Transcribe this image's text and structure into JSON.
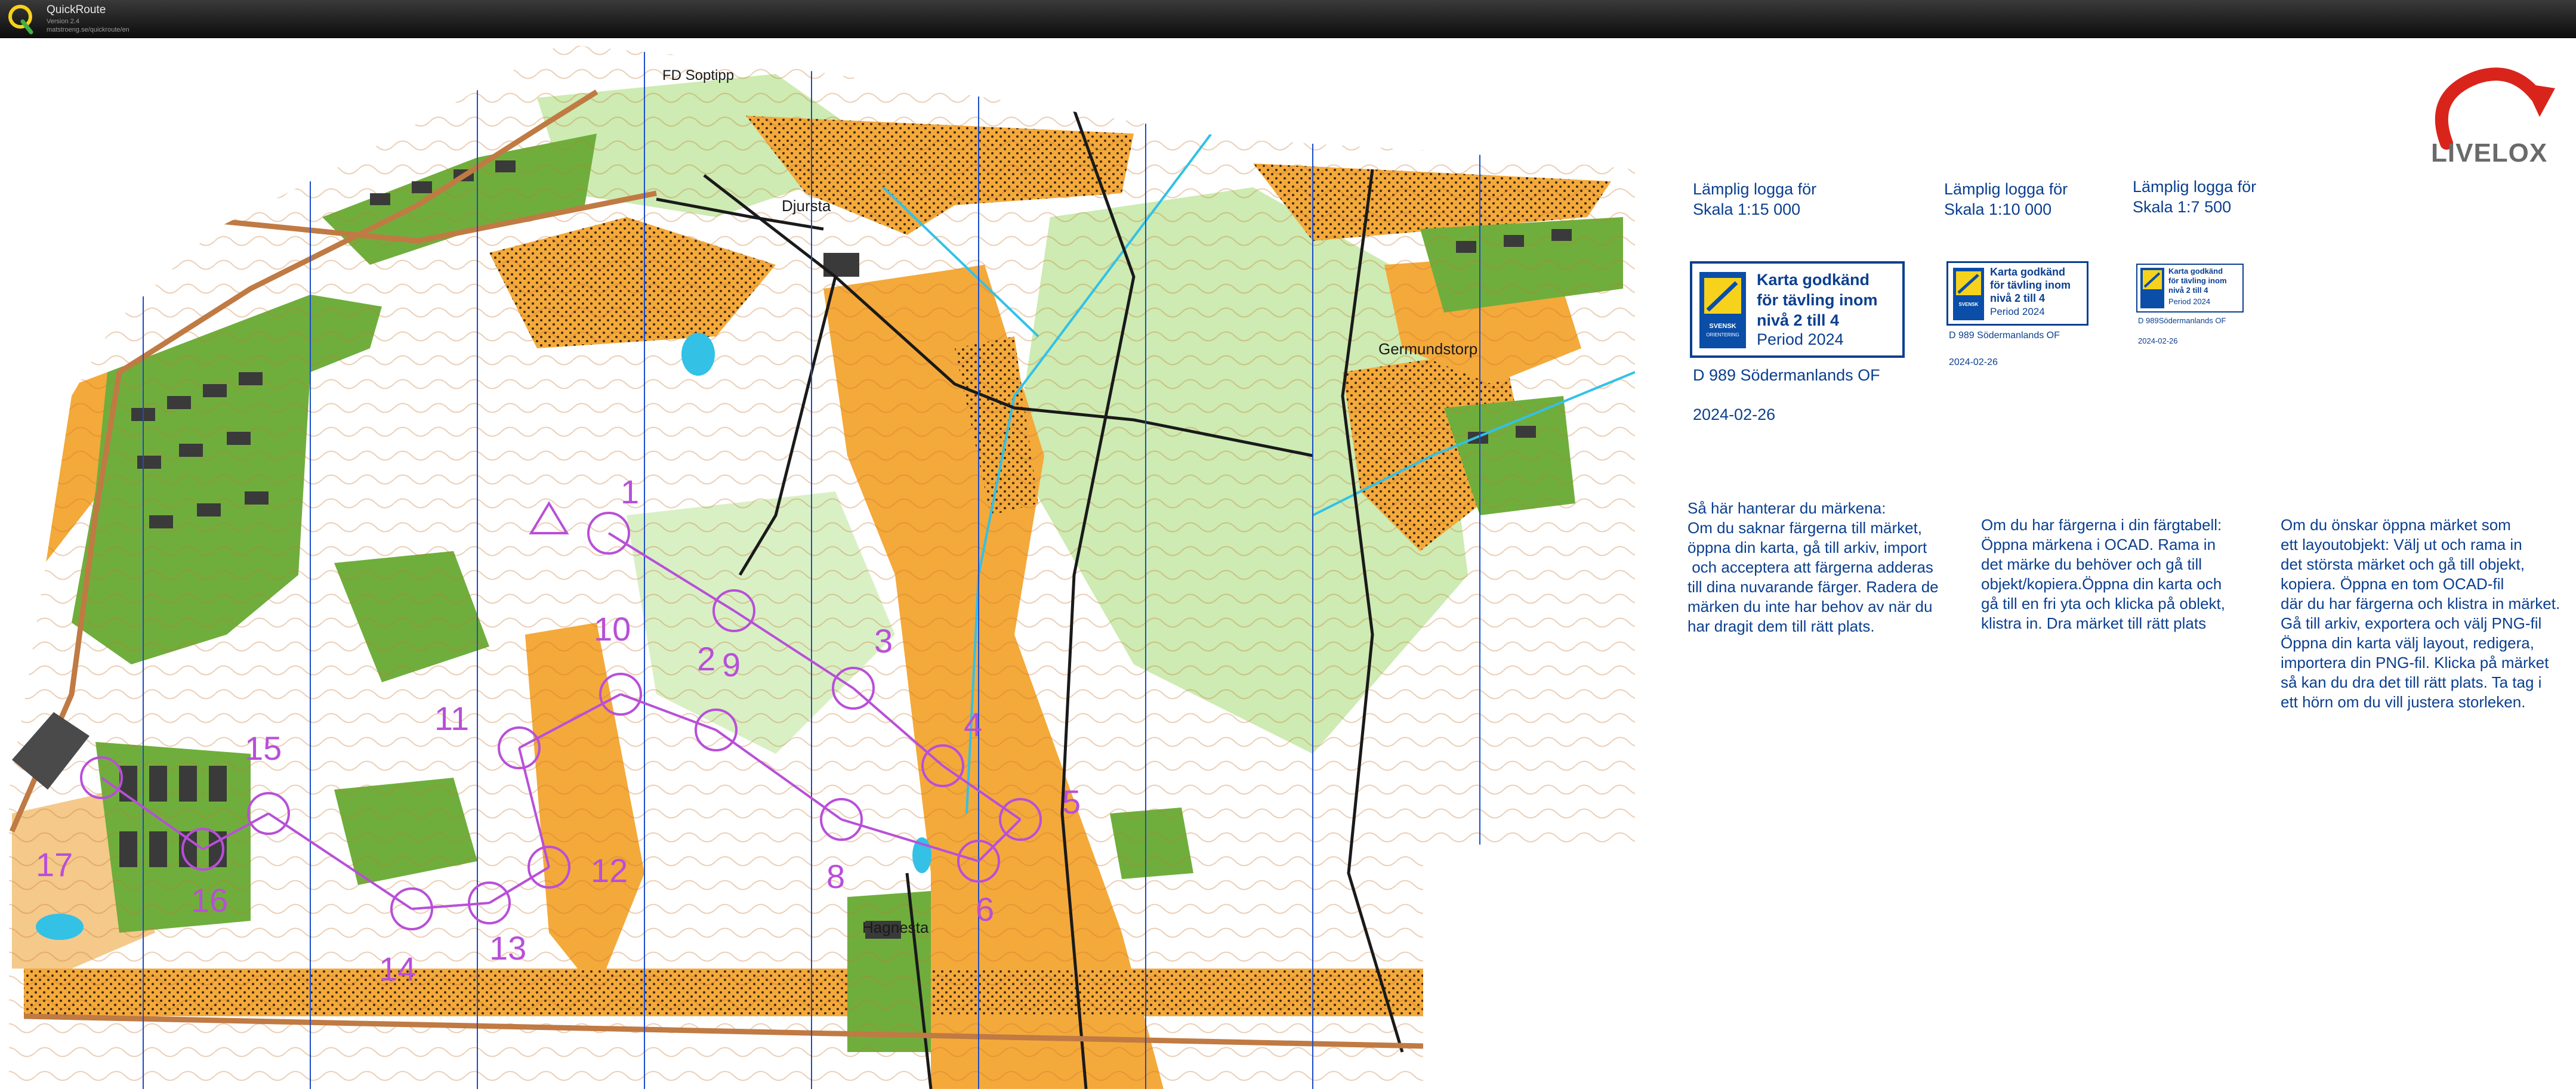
{
  "app": {
    "title": "QuickRoute",
    "version": "Version 2.4",
    "url": "matstroeng.se/quickroute/en"
  },
  "colors": {
    "titlebar": "#141414",
    "open_land": "#f4a93b",
    "forest": "#ffffff",
    "green": "#9ed17a",
    "dark_green": "#3f8a2a",
    "course": "#b84fd8",
    "road": "#c07a43",
    "contour": "#c9752d",
    "water": "#33c1e6",
    "legend_blue": "#0b3f8f"
  },
  "map": {
    "place_names": [
      {
        "id": "fd-soptipp",
        "text": "FD Soptipp"
      },
      {
        "id": "djursta",
        "text": "Djursta"
      },
      {
        "id": "germundstorp",
        "text": "Germundstorp"
      },
      {
        "id": "hagnesta",
        "text": "Hagnesta"
      }
    ],
    "controls": [
      {
        "label": "1"
      },
      {
        "label": "2"
      },
      {
        "label": "3"
      },
      {
        "label": "4"
      },
      {
        "label": "5"
      },
      {
        "label": "6"
      },
      {
        "label": "8"
      },
      {
        "label": "9"
      },
      {
        "label": "10"
      },
      {
        "label": "11"
      },
      {
        "label": "12"
      },
      {
        "label": "13"
      },
      {
        "label": "14"
      },
      {
        "label": "15"
      },
      {
        "label": "16"
      },
      {
        "label": "17"
      }
    ]
  },
  "legend": {
    "cols": [
      {
        "line1": "Lämplig logga för",
        "line2": "Skala 1:15 000"
      },
      {
        "line1": "Lämplig logga för",
        "line2": "Skala 1:10 000"
      },
      {
        "line1": "Lämplig logga för",
        "line2": "Skala 1:7 500"
      }
    ],
    "badge_text": "Karta godkänd\nför tävling inom\nnivå 2 till 4",
    "badge_period": "Period 2024",
    "badge_org": "SVENSK\nORIENTERING",
    "org_large": "D 989 Södermanlands OF",
    "date_large": "2024-02-26",
    "org_medium": "D 989 Södermanlands OF",
    "date_medium": "2024-02-26",
    "org_small": "D 989Södermanlands OF",
    "date_small": "2024-02-26"
  },
  "instructions": {
    "p1": "Så här hanterar du märkena:\nOm du saknar färgerna till märket,\nöppna din karta, gå till arkiv, import\n och acceptera att färgerna adderas\ntill dina nuvarande färger. Radera de\nmärken du inte har behov av när du\nhar dragit dem till rätt plats.",
    "p2": "Om du har färgerna i din färgtabell:\nÖppna märkena i OCAD. Rama in\ndet märke du behöver och gå till\nobjekt/kopiera.Öppna din karta och\ngå till en fri yta och klicka på oblekt,\nklistra in. Dra märket till rätt plats",
    "p3": "Om du önskar öppna märket som\nett layoutobjekt: Välj ut och rama in\ndet största märket och gå till objekt,\nkopiera. Öppna en tom OCAD-fil\ndär du har färgerna och klistra in märket.\nGå till arkiv, exportera och välj PNG-fil\nÖppna din karta välj layout, redigera,\nimportera din PNG-fil. Klicka på märket\nså kan du dra det till rätt plats. Ta tag i\nett hörn om du vill justera storleken."
  },
  "logo": {
    "text": "LIVELOX"
  }
}
